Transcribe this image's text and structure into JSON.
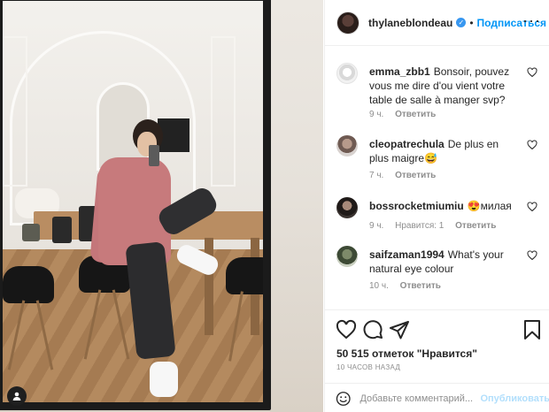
{
  "post": {
    "username": "thylaneblondeau",
    "verified_mark": "✓",
    "separator": "•",
    "follow_label": "Подписаться",
    "more_label": "···"
  },
  "comments": [
    {
      "user": "emma_zbb1",
      "text": "Bonsoir, pouvez vous me dire d'ou vient votre table de salle à manger svp?",
      "time": "9 ч.",
      "likes": "",
      "reply": "Ответить"
    },
    {
      "user": "cleopatrechula",
      "text": "De plus en plus maigre😅",
      "time": "7 ч.",
      "likes": "",
      "reply": "Ответить"
    },
    {
      "user": "bossrocketmiumiu",
      "text": "😍милая",
      "time": "9 ч.",
      "likes": "Нравится: 1",
      "reply": "Ответить"
    },
    {
      "user": "saifzaman1994",
      "text": "What's your natural eye colour",
      "time": "10 ч.",
      "likes": "",
      "reply": "Ответить"
    }
  ],
  "footer": {
    "likes_text": "50 515 отметок \"Нравится\"",
    "time_ago": "10 ЧАСОВ НАЗАД",
    "comment_placeholder": "Добавьте комментарий...",
    "publish_label": "Опубликовать"
  },
  "colors": {
    "accent": "#0095f6",
    "muted": "#8e8e8e",
    "publish_disabled": "#b2dffc"
  },
  "icons": [
    "heart-icon",
    "comment-icon",
    "share-icon",
    "bookmark-icon",
    "smiley-icon",
    "user-tag-icon",
    "more-icon"
  ]
}
